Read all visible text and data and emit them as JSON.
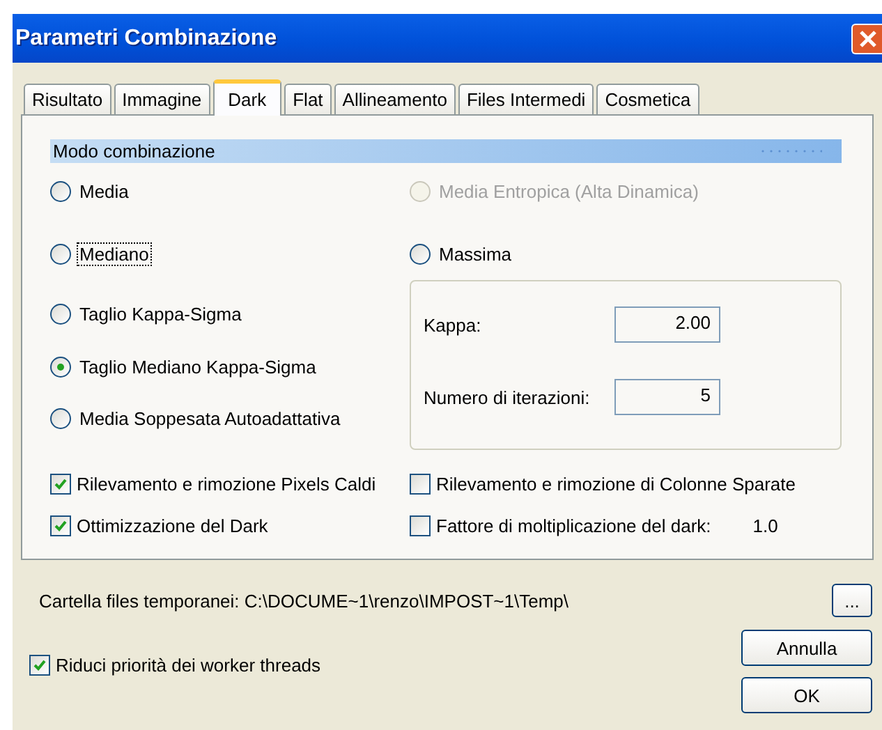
{
  "window": {
    "title": "Parametri Combinazione"
  },
  "tabs": [
    {
      "label": "Risultato",
      "selected": false
    },
    {
      "label": "Immagine",
      "selected": false
    },
    {
      "label": "Dark",
      "selected": true
    },
    {
      "label": "Flat",
      "selected": false
    },
    {
      "label": "Allineamento",
      "selected": false
    },
    {
      "label": "Files Intermedi",
      "selected": false
    },
    {
      "label": "Cosmetica",
      "selected": false
    }
  ],
  "group": {
    "title": "Modo combinazione"
  },
  "modes_left": [
    {
      "label": "Media",
      "selected": false,
      "disabled": false,
      "focused": false
    },
    {
      "label": "Mediano",
      "selected": false,
      "disabled": false,
      "focused": true
    },
    {
      "label": "Taglio Kappa-Sigma",
      "selected": false,
      "disabled": false,
      "focused": false
    },
    {
      "label": "Taglio Mediano Kappa-Sigma",
      "selected": true,
      "disabled": false,
      "focused": false
    },
    {
      "label": "Media Soppesata Autoadattativa",
      "selected": false,
      "disabled": false,
      "focused": false
    }
  ],
  "modes_right": [
    {
      "label": "Media Entropica (Alta Dinamica)",
      "selected": false,
      "disabled": true,
      "focused": false
    },
    {
      "label": "Massima",
      "selected": false,
      "disabled": false,
      "focused": false
    }
  ],
  "params": [
    {
      "label": "Kappa:",
      "value": "2.00"
    },
    {
      "label": "Numero di iterazioni:",
      "value": "5"
    }
  ],
  "checks_left": [
    {
      "label": "Rilevamento e rimozione Pixels Caldi",
      "checked": true
    },
    {
      "label": "Ottimizzazione del Dark",
      "checked": true
    }
  ],
  "checks_right": [
    {
      "label": "Rilevamento e rimozione di Colonne Sparate",
      "checked": false
    },
    {
      "label": "Fattore di moltiplicazione del dark:",
      "checked": false,
      "value": "1.0"
    }
  ],
  "temp_folder": {
    "label": "Cartella files temporanei: C:\\DOCUME~1\\renzo\\IMPOST~1\\Temp\\",
    "browse": "..."
  },
  "worker_check": {
    "label": "Riduci priorità dei worker threads",
    "checked": true
  },
  "buttons": [
    "Annulla",
    "OK"
  ]
}
